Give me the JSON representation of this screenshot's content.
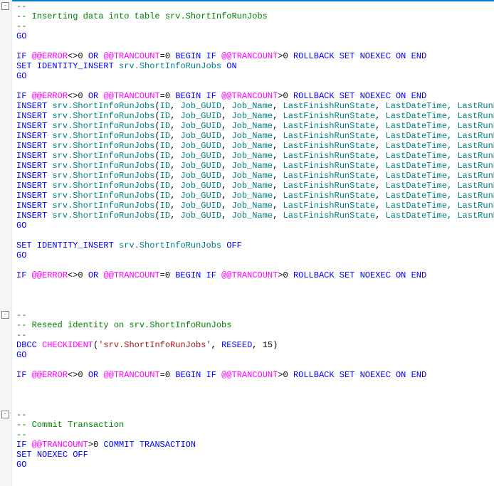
{
  "comments": {
    "dash": "--",
    "insert_header": "-- Inserting data into table srv.ShortInfoRunJobs",
    "reseed_header": "-- Reseed identity on srv.ShortInfoRunJobs",
    "commit_header": "-- Commit Transaction"
  },
  "kw": {
    "GO": "GO",
    "IF": "IF",
    "OR": "OR",
    "BEGIN": "BEGIN",
    "ROLLBACK": "ROLLBACK",
    "SET": "SET",
    "NOEXEC": "NOEXEC",
    "ON": "ON",
    "OFF": "OFF",
    "END": "END",
    "IDENTITY_INSERT": "IDENTITY_INSERT",
    "INSERT": "INSERT",
    "DBCC": "DBCC",
    "RESEED": "RESEED",
    "COMMIT": "COMMIT",
    "TRANSACTION": "TRANSACTION"
  },
  "gv": {
    "ERROR": "@@ERROR",
    "TRANCOUNT": "@@TRANCOUNT"
  },
  "ops": {
    "ne0": "<>0",
    "eq0": "=0",
    "gt0": ">0"
  },
  "fn": {
    "CHECKIDENT": "CHECKIDENT"
  },
  "obj": {
    "table": "srv.ShortInfoRunJobs"
  },
  "str": {
    "table_quoted": "'srv.ShortInfoRunJobs'"
  },
  "cols": {
    "open": "(",
    "close_cut": ", LastRunD",
    "ID": "ID",
    "Job_GUID": "Job_GUID",
    "Job_Name": "Job_Name",
    "LastFinishRunState": "LastFinishRunState",
    "LastDateTime": "LastDateTime"
  },
  "nums": {
    "fifteen": "15"
  },
  "folds": [
    {
      "line": 0,
      "sym": "-"
    },
    {
      "line": 31,
      "sym": "-"
    },
    {
      "line": 41,
      "sym": "-"
    }
  ]
}
